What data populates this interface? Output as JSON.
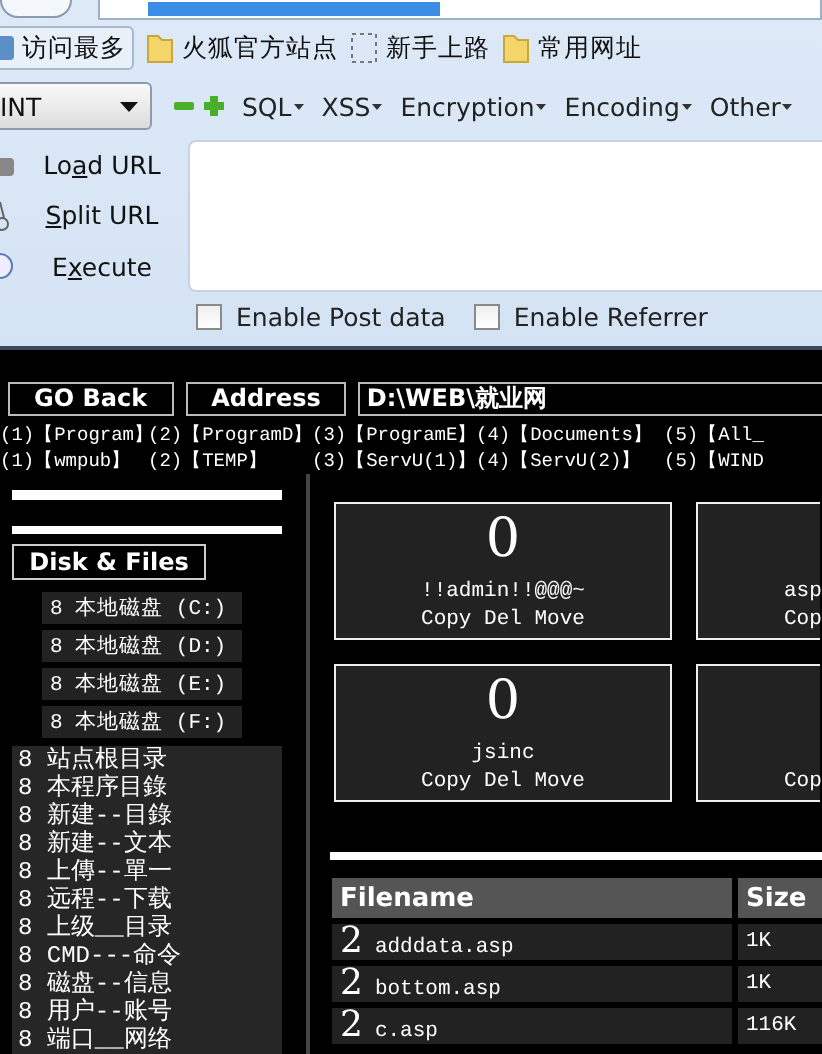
{
  "browser": {
    "bookmarks": [
      {
        "label": "访问最多",
        "kind": "button"
      },
      {
        "label": "火狐官方站点",
        "kind": "folder"
      },
      {
        "label": "新手上路",
        "kind": "page"
      },
      {
        "label": "常用网址",
        "kind": "folder"
      }
    ]
  },
  "hackbar": {
    "type_select": "INT",
    "menus": [
      "SQL",
      "XSS",
      "Encryption",
      "Encoding",
      "Other"
    ],
    "actions": [
      {
        "kind": "load",
        "pre": "Lo",
        "key": "a",
        "post": "d URL"
      },
      {
        "kind": "split",
        "key": "S",
        "post": "plit URL"
      },
      {
        "kind": "execute",
        "pre": "E",
        "key": "x",
        "post": "ecute"
      }
    ],
    "checkboxes": [
      {
        "label": "Enable Post data",
        "checked": false
      },
      {
        "label": "Enable Referrer",
        "checked": false
      }
    ]
  },
  "webshell": {
    "nav_buttons": [
      "GO Back",
      "Address"
    ],
    "address": "D:\\WEB\\就业网",
    "shortcut_rows": [
      [
        "(1)【Program】",
        "(2)【ProgramD】",
        "(3)【ProgramE】",
        "(4)【Documents】",
        "(5)【All_"
      ],
      [
        "(1)【wmpub】",
        "(2)【TEMP】",
        "(3)【ServU(1)】",
        "(4)【ServU(2)】",
        "(5)【WIND"
      ]
    ],
    "disk_title": "Disk & Files",
    "disks": [
      "8 本地磁盘 (C:)",
      "8 本地磁盘 (D:)",
      "8 本地磁盘 (E:)",
      "8 本地磁盘 (F:)"
    ],
    "tools": [
      "8 站点根目录",
      "8 本程序目錄",
      "8 新建--目錄",
      "8 新建--文本",
      "8 上傳--單一",
      "8 远程--下载",
      "8 上级__目录",
      "8 CMD---命令",
      "8 磁盘--信息",
      "8 用户--账号",
      "8 端口__网络"
    ],
    "folders": [
      {
        "count": "0",
        "name": "!!admin!!@@@~",
        "actions": "Copy Del Move"
      },
      {
        "name": "asp",
        "actions": "Cop"
      },
      {
        "count": "0",
        "name": "jsinc",
        "actions": "Copy Del Move"
      },
      {
        "actions": "Cop"
      }
    ],
    "table": {
      "columns": [
        "Filename",
        "Size"
      ],
      "rows": [
        {
          "icon": "2",
          "name": "adddata.asp",
          "size": "1K"
        },
        {
          "icon": "2",
          "name": "bottom.asp",
          "size": "1K"
        },
        {
          "icon": "2",
          "name": "c.asp",
          "size": "116K"
        }
      ]
    }
  }
}
